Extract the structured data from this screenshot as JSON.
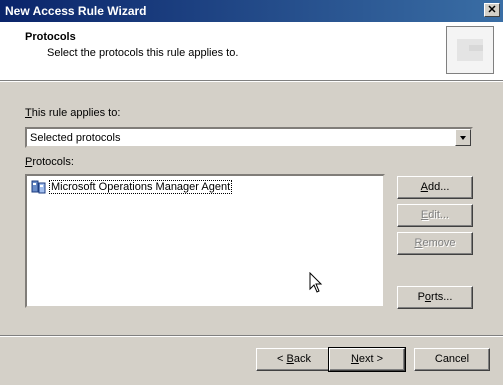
{
  "window": {
    "title": "New Access Rule Wizard"
  },
  "header": {
    "title": "Protocols",
    "subtitle": "Select the protocols this rule applies to."
  },
  "applies": {
    "label_prefix": "",
    "label_accel": "T",
    "label_rest": "his rule applies to:",
    "selected_value": "Selected protocols"
  },
  "protocols": {
    "label_accel": "P",
    "label_rest": "rotocols:",
    "items": [
      {
        "label": "Microsoft Operations Manager Agent",
        "icon": "protocol-icon"
      }
    ]
  },
  "side_buttons": {
    "add": {
      "accel": "A",
      "rest": "dd..."
    },
    "edit": {
      "accel": "E",
      "rest": "dit..."
    },
    "remove": {
      "accel": "R",
      "rest": "emove"
    },
    "ports": {
      "pre": "P",
      "accel": "o",
      "rest": "rts..."
    }
  },
  "footer": {
    "back": {
      "prefix": "< ",
      "accel": "B",
      "rest": "ack"
    },
    "next": {
      "accel": "N",
      "rest": "ext >"
    },
    "cancel": "Cancel"
  },
  "colors": {
    "titlebar_start": "#0a246a",
    "titlebar_end": "#3a6ea5",
    "face": "#d4d0c8"
  }
}
